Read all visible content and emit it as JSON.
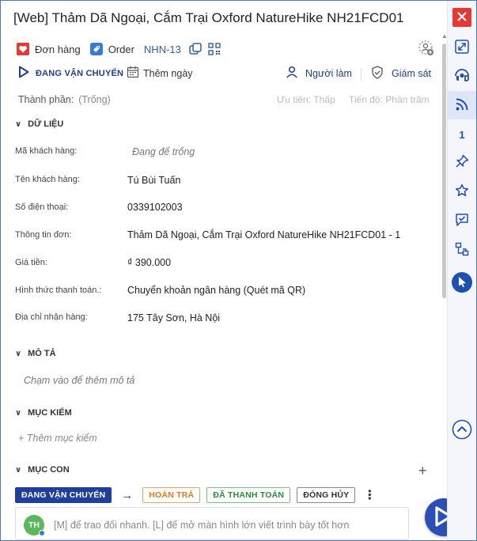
{
  "task": {
    "title": "[Web] Thảm Dã Ngoại, Cắm Trại Oxford NatureHike NH21FCD01"
  },
  "header": {
    "order_type_label": "Đơn hàng",
    "order_label": "Order",
    "code": "NHN-13"
  },
  "toolbar": {
    "status_label": "ĐANG VẬN CHUYỂN",
    "add_day_label": "Thêm ngày",
    "assignee_label": "Người làm",
    "supervisor_label": "Giám sát"
  },
  "meta": {
    "component_label": "Thành phần:",
    "component_value": "(Trống)",
    "priority_label": "Ưu tiên:",
    "priority_value": "Thấp",
    "progress_label": "Tiến độ:",
    "progress_value": "Phần trăm"
  },
  "sections": {
    "data": "DỮ LIỆU",
    "description": "MÔ TẢ",
    "checklist": "MỤC KIỂM",
    "subtasks": "MỤC CON"
  },
  "fields": [
    {
      "label": "Mã khách hàng:",
      "value": "Đang để trống",
      "empty": true
    },
    {
      "label": "Tên khách hàng:",
      "value": "Tú Bùi Tuấn"
    },
    {
      "label": "Số điện thoại:",
      "value": "0339102003"
    },
    {
      "label": "Thông tin đơn:",
      "value": "Thảm Dã Ngoại, Cắm Trại Oxford NatureHike NH21FCD01 - 1"
    },
    {
      "label": "Giá tiền:",
      "value": "₫ 390.000"
    },
    {
      "label": "Hình thức thanh toán.:",
      "value": "Chuyển khoản ngân hàng (Quét mã QR)"
    },
    {
      "label": "Địa chỉ nhận hàng:",
      "value": "175 Tây Sơn, Hà Nội"
    }
  ],
  "description": {
    "placeholder": "Chạm vào để thêm mô tả"
  },
  "checklist": {
    "add_label": "+ Thêm mục kiểm"
  },
  "workflow": {
    "current": "ĐANG VẬN CHUYỂN",
    "next": [
      "HOÀN TRẢ",
      "ĐÃ THANH TOÁN",
      "ĐÓNG HỦY"
    ]
  },
  "comment": {
    "avatar_initials": "TH",
    "placeholder": "[M] để trao đổi nhanh. [L] để mở màn hình lớn viết trình bày tốt hơn"
  },
  "sidebar": {
    "follow_count": "1"
  },
  "colors": {
    "accent": "#1f3f9a",
    "close": "#e53935",
    "orange": "#e07a1a",
    "green": "#2e8b3a",
    "heart": "#e53935"
  }
}
